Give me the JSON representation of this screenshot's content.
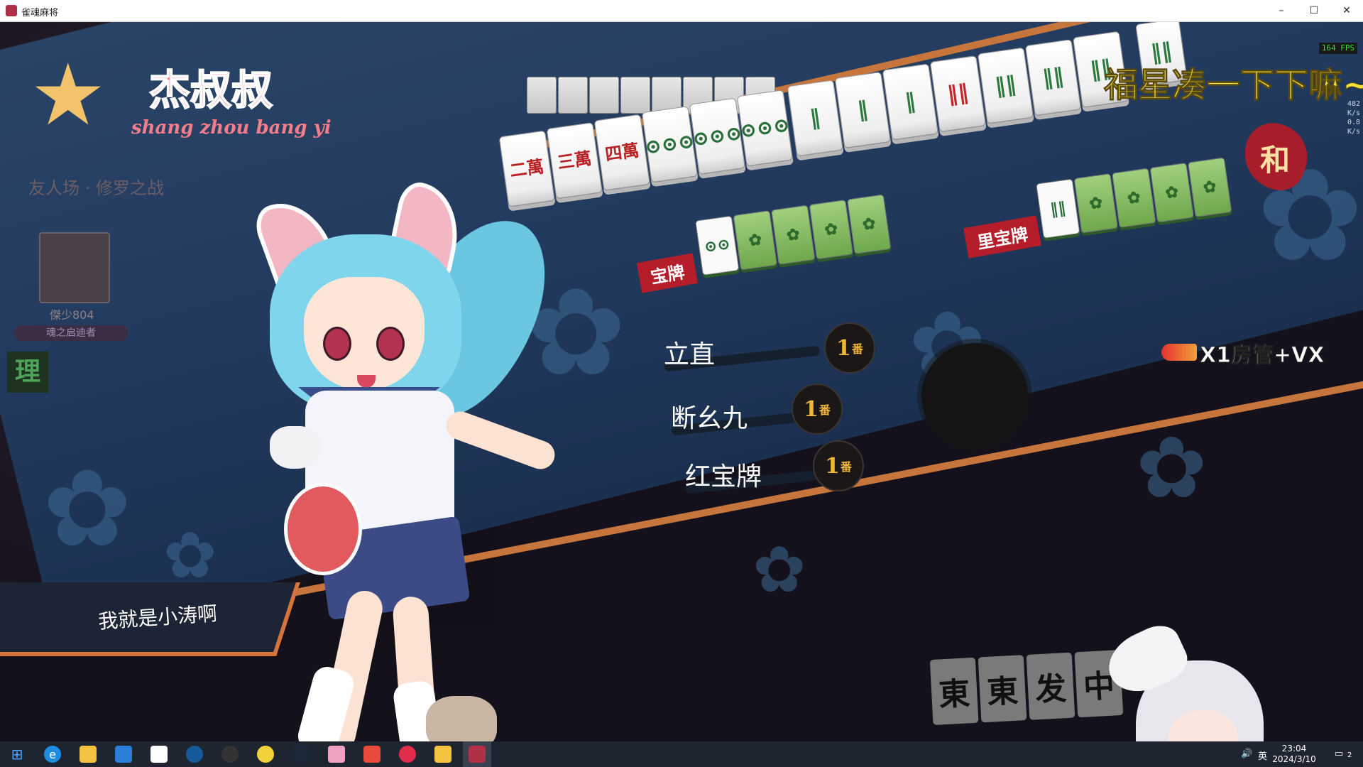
{
  "window": {
    "title": "雀魂麻将",
    "minimize": "–",
    "maximize": "☐",
    "close": "✕"
  },
  "overlay": {
    "logo_name": "杰叔叔",
    "logo_sub": "shang zhou bang yi",
    "banner": "福星凑一下下嘛~",
    "ad": "X1房管+VX",
    "fps": "164 FPS",
    "net_up": "482",
    "net_up_unit": "K/s",
    "net_down": "0.8",
    "net_down_unit": "K/s"
  },
  "opponent": {
    "match_title": "友人场 · 修罗之战",
    "name": "傑少804",
    "title": "魂之启迪者",
    "badge": "理"
  },
  "hand": {
    "tiles": [
      "二萬",
      "三萬",
      "四萬",
      "⊙⊙⊙",
      "⊙⊙⊙",
      "⊙⊙⊙",
      "‖",
      "‖",
      "‖",
      "‖‖",
      "‖‖",
      "‖‖",
      "‖‖",
      "‖‖"
    ]
  },
  "dora": {
    "label": "宝牌",
    "tiles": [
      "⊙⊙",
      "",
      "",
      "",
      ""
    ],
    "ura_label": "里宝牌",
    "ura_tiles": [
      "‖‖",
      "",
      "",
      "",
      ""
    ]
  },
  "yaku": [
    {
      "name": "立直",
      "han": "1",
      "han_unit": "番"
    },
    {
      "name": "断幺九",
      "han": "1",
      "han_unit": "番"
    },
    {
      "name": "红宝牌",
      "han": "1",
      "han_unit": "番"
    }
  ],
  "win_mark": "和",
  "winner_name": "我就是小涛啊",
  "bottom_tiles": [
    "東",
    "東",
    "发",
    "中"
  ],
  "taskbar": {
    "time": "23:04",
    "date": "2024/3/10",
    "notifications": "2",
    "ime": "英",
    "apps": [
      "windows-start",
      "edge",
      "file-explorer",
      "app-blue",
      "app-qq",
      "app-5",
      "app-6",
      "app-7",
      "steam",
      "app-pink",
      "app-red",
      "app-netease",
      "app-owl",
      "app-mahjongsoul"
    ]
  }
}
